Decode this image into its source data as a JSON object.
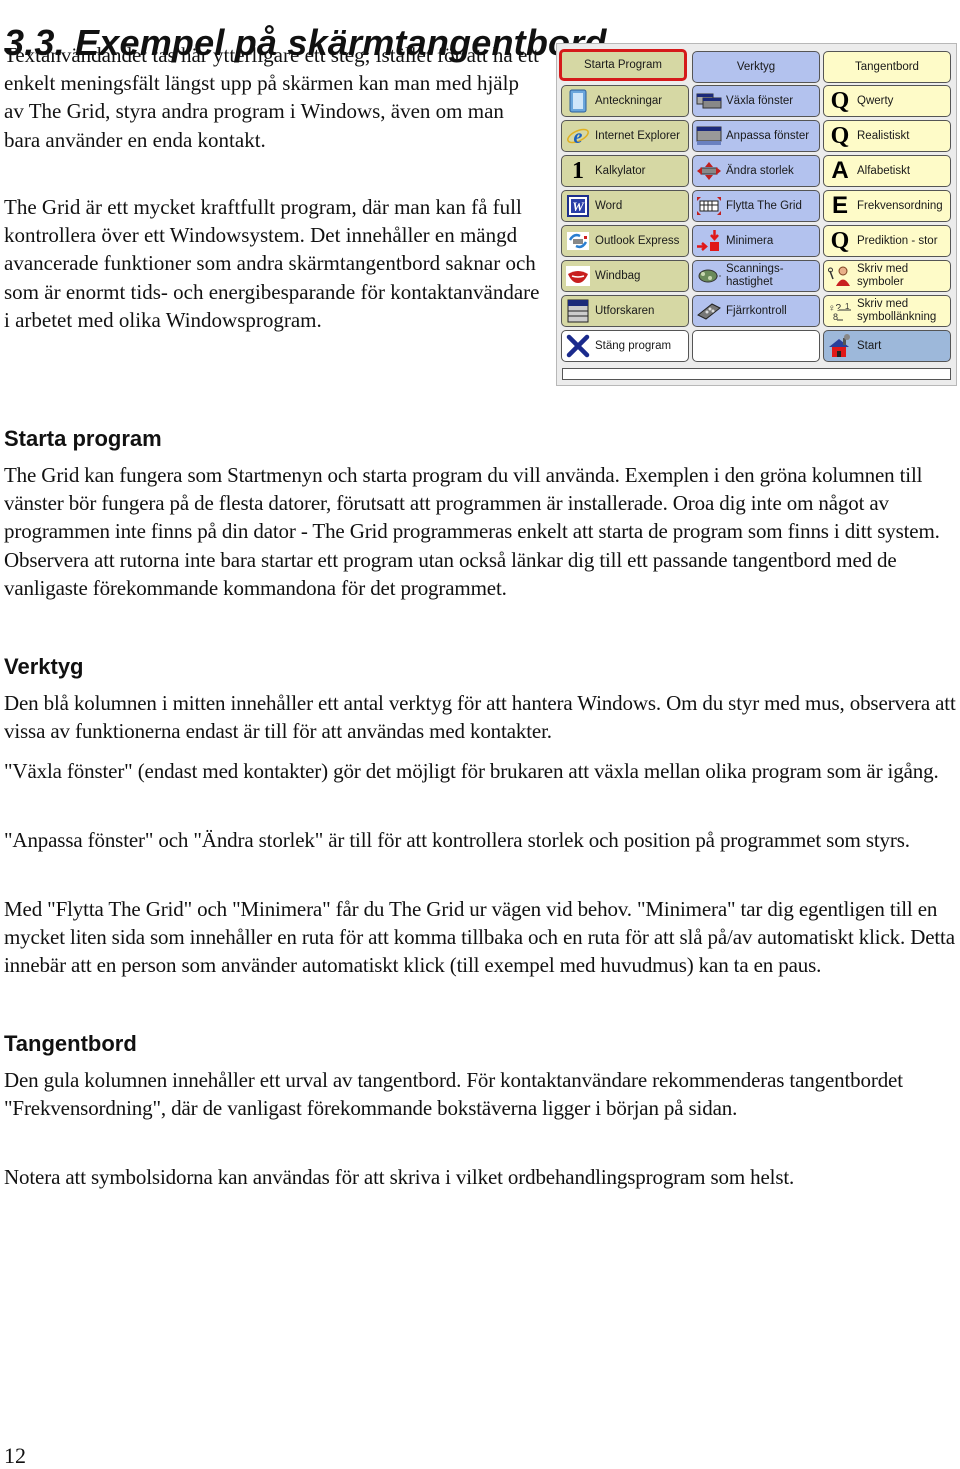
{
  "title": "3.3. Exempel på skärmtangentbord",
  "intro": [
    "Textanvändandet tas här ytterligare ett steg; istället för att ha ett enkelt meningsfält längst upp på skärmen kan man med hjälp av The Grid, styra andra program i Windows, även om man bara använder en enda kontakt.",
    "The Grid är ett mycket kraftfullt program, där man kan få full kontrollera över ett Windowsystem. Det innehåller en mängd avancerade funktioner som andra skärmtangentbord saknar och som är enormt tids- och energibesparande för kontaktanvändare i arbetet med olika Windowsprogram."
  ],
  "grid": {
    "columns": [
      {
        "header": "Starta Program",
        "color": "#d6d8a4",
        "selected": true,
        "items": [
          {
            "label": "Anteckningar",
            "icon": "notepad-icon"
          },
          {
            "label": "Internet Explorer",
            "icon": "internet-explorer-icon"
          },
          {
            "label": "Kalkylator",
            "icon": "number-one-icon",
            "glyph": "1"
          },
          {
            "label": "Word",
            "icon": "word-icon",
            "glyph": "W"
          },
          {
            "label": "Outlook Express",
            "icon": "outlook-express-icon"
          },
          {
            "label": "Windbag",
            "icon": "lips-icon"
          },
          {
            "label": "Utforskaren",
            "icon": "explorer-icon"
          },
          {
            "label": "Stäng program",
            "icon": "close-x-icon",
            "glyph": "✕"
          }
        ]
      },
      {
        "header": "Verktyg",
        "color": "#b3c2ee",
        "items": [
          {
            "label": "Växla fönster",
            "icon": "switch-windows-icon"
          },
          {
            "label": "Anpassa fönster",
            "icon": "adjust-window-icon"
          },
          {
            "label": "Ändra storlek",
            "icon": "resize-icon"
          },
          {
            "label": "Flytta The Grid",
            "icon": "move-grid-icon"
          },
          {
            "label": "Minimera",
            "icon": "minimize-icon"
          },
          {
            "label": "Scannings-hastighet",
            "label_lines": [
              "Scannings-",
              "hastighet"
            ],
            "icon": "scanning-speed-icon"
          },
          {
            "label": "Fjärrkontroll",
            "icon": "remote-control-icon"
          },
          {
            "label": "",
            "icon": ""
          }
        ]
      },
      {
        "header": "Tangentbord",
        "color": "#fefbc8",
        "items": [
          {
            "label": "Qwerty",
            "icon": "letter-q-icon",
            "glyph": "Q"
          },
          {
            "label": "Realistiskt",
            "icon": "letter-q-icon",
            "glyph": "Q"
          },
          {
            "label": "Alfabetiskt",
            "icon": "letter-a-icon",
            "glyph": "A"
          },
          {
            "label": "Frekvensordning",
            "icon": "letter-e-icon",
            "glyph": "E"
          },
          {
            "label": "Prediktion - stor",
            "icon": "letter-q-icon",
            "glyph": "Q"
          },
          {
            "label": "Skriv med symboler",
            "label_lines": [
              "Skriv med",
              "symboler"
            ],
            "icon": "symbol-person-icon"
          },
          {
            "label": "Skriv med symbollänkning",
            "label_lines": [
              "Skriv med",
              "symbollänkning"
            ],
            "icon": "symbol-link-icon"
          },
          {
            "label": "Start",
            "icon": "home-icon",
            "color": "#9db8da"
          }
        ]
      }
    ],
    "message_bar": ""
  },
  "sections": {
    "starta": {
      "heading": "Starta program",
      "paragraphs": [
        "The Grid kan fungera som Startmenyn och starta program du vill använda. Exemplen i den gröna kolumnen till vänster bör fungera på de flesta datorer, förutsatt att programmen är installerade. Oroa dig inte om något av programmen inte finns på din dator - The Grid programmeras enkelt att starta de program som finns i ditt system. Observera att rutorna inte bara startar ett program utan också länkar dig till ett passande tangentbord med de vanligaste förekommande kommandona för det programmet."
      ]
    },
    "verktyg": {
      "heading": "Verktyg",
      "paragraphs": [
        "Den blå kolumnen i mitten innehåller ett antal verktyg för att hantera Windows. Om du styr med mus, observera att vissa av funktionerna endast är till för att användas med kontakter.",
        "\"Växla fönster\" (endast med kontakter) gör det möjligt för brukaren att växla mellan olika program som är igång.",
        "\"Anpassa fönster\" och \"Ändra storlek\" är till för att kontrollera storlek och position på programmet som styrs.",
        "Med \"Flytta The Grid\" och \"Minimera\" får du The Grid ur vägen vid behov. \"Minimera\" tar dig egentligen till en mycket liten sida som innehåller en ruta för att komma tillbaka och en ruta för att slå på/av automatiskt klick. Detta innebär att en person som använder automatiskt klick (till exempel med huvudmus) kan ta en paus."
      ]
    },
    "tangentbord": {
      "heading": "Tangentbord",
      "paragraphs": [
        "Den gula kolumnen innehåller ett urval av tangentbord. För kontaktanvändare rekommenderas tangentbordet \"Frekvensordning\", där de vanligast förekommande bokstäverna ligger i början på sidan.",
        "Notera att symbolsidorna kan användas för att skriva i vilket ordbehandlingsprogram som helst."
      ]
    }
  },
  "page_number": "12"
}
